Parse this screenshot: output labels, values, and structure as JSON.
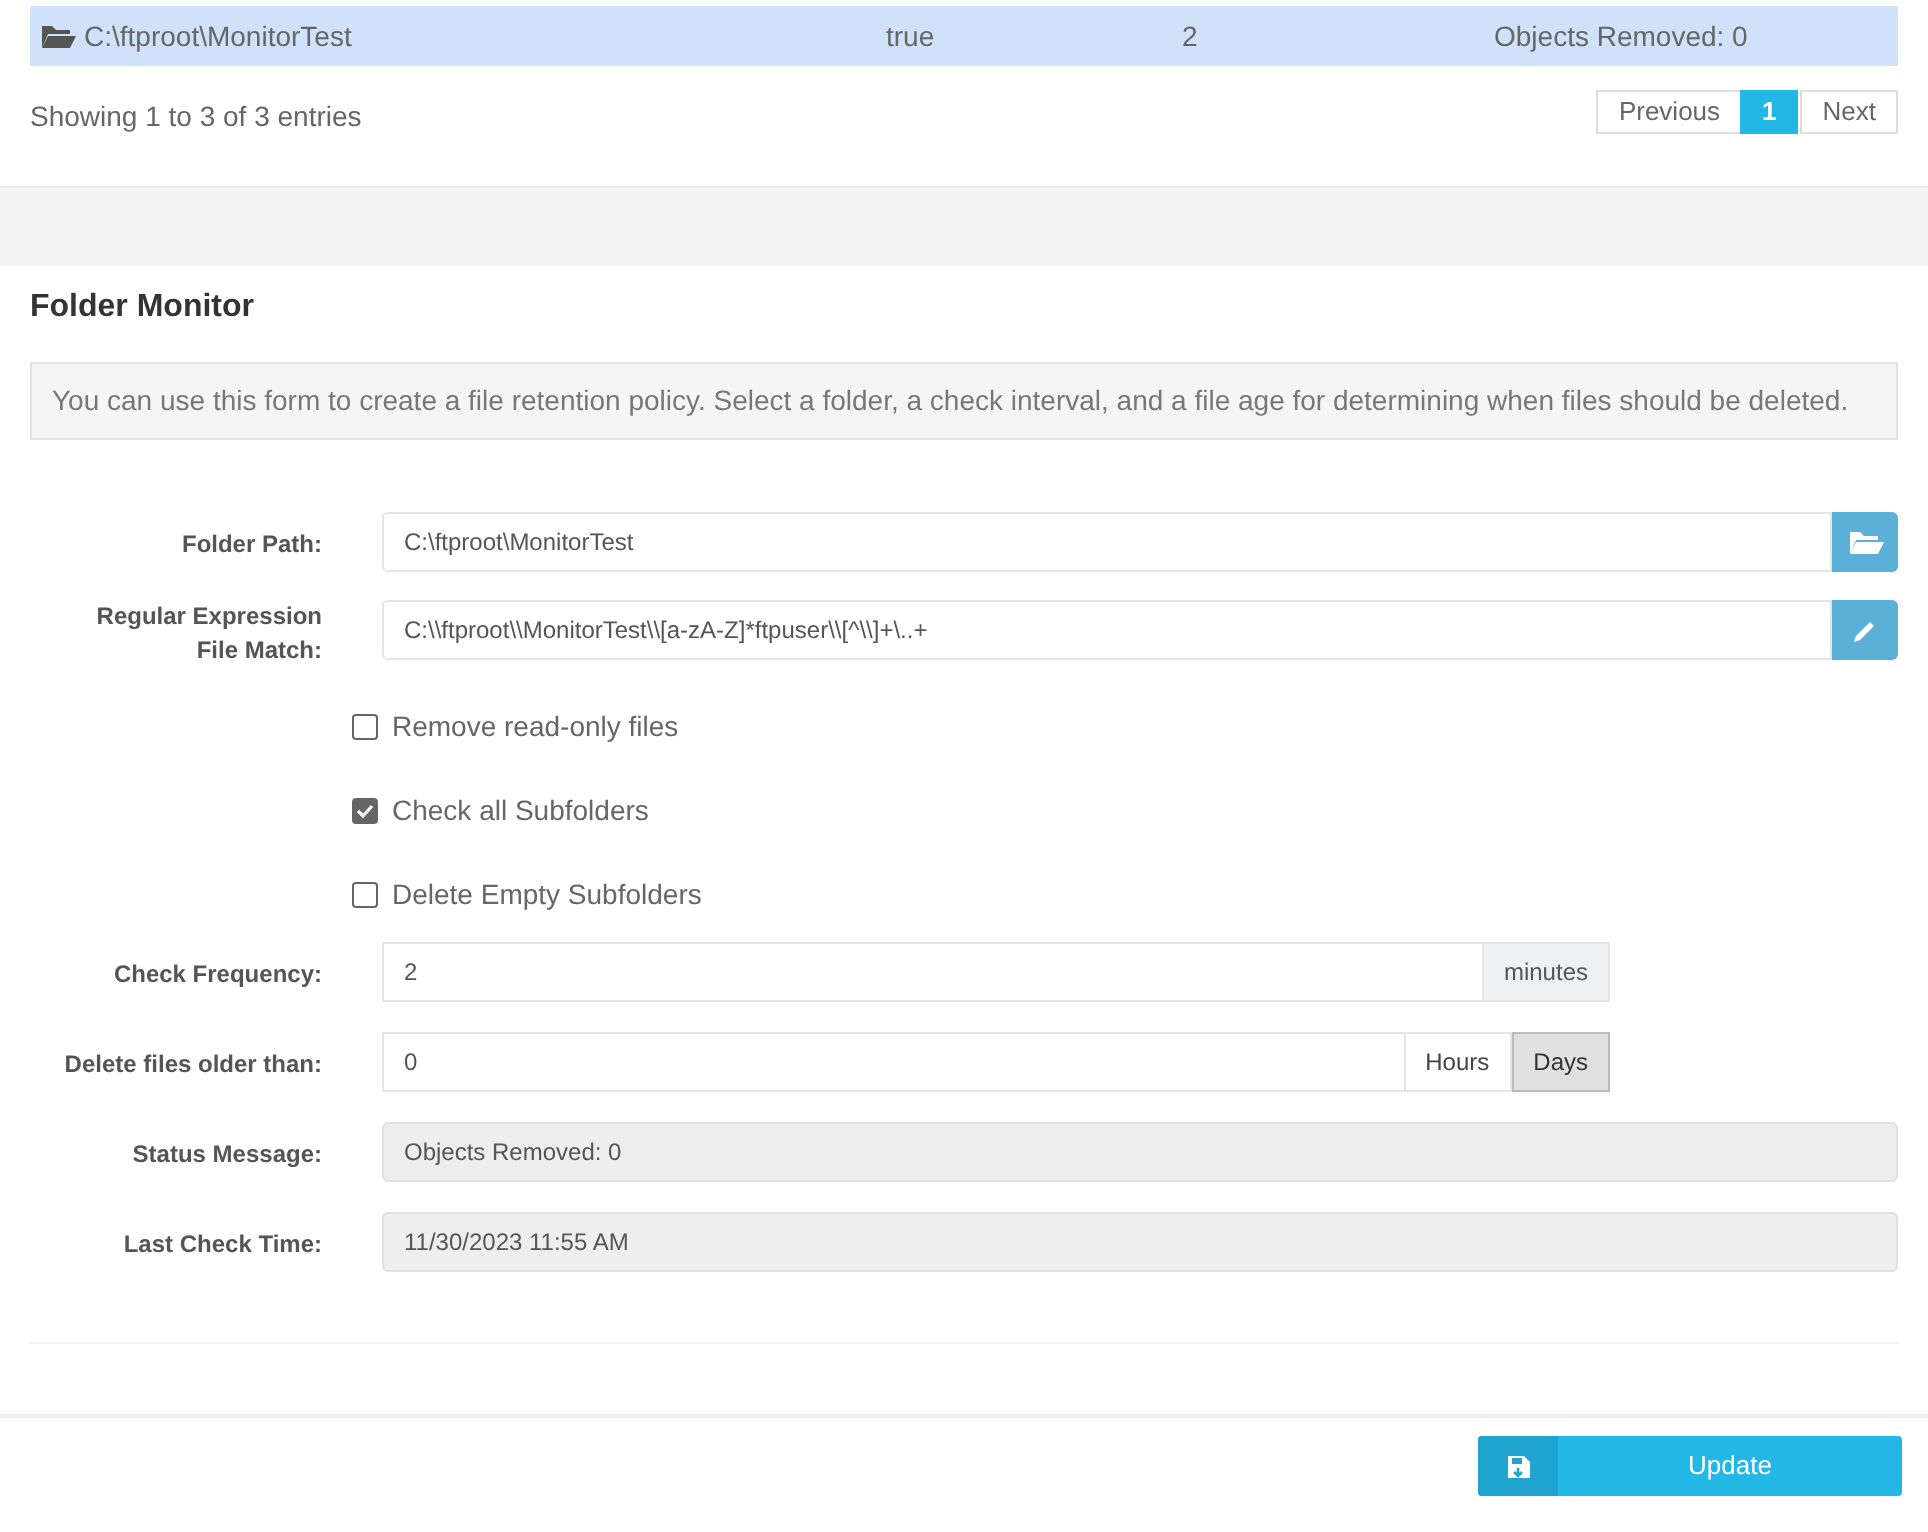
{
  "table": {
    "rows": [
      {
        "path": "C:\\ftproot\\MonitorTest",
        "column_2": "true",
        "column_3": "2",
        "column_4": "Objects Removed: 0",
        "selected": true
      }
    ]
  },
  "table_info": "Showing 1 to 3 of 3 entries",
  "pagination": [
    {
      "label": "Previous",
      "selected": false
    },
    {
      "label": "1",
      "selected": true
    },
    {
      "label": "Next",
      "selected": false
    }
  ],
  "panel": {
    "title": "Folder Monitor",
    "info": "You can use this form to create a file retention policy. Select a folder, a check interval, and a file age for determining when files should be deleted."
  },
  "folder_path": {
    "label": "Folder Path:",
    "value": "C:\\ftproot\\MonitorTest"
  },
  "regex": {
    "label": "Regular Expression File Match:",
    "value": "C:\\\\ftproot\\\\MonitorTest\\\\[a-zA-Z]*ftpuser\\\\[^\\\\]+\\..+"
  },
  "options": [
    {
      "label": "Remove read-only files",
      "checked": false
    },
    {
      "label": "Check all Subfolders",
      "checked": true
    },
    {
      "label": "Delete Empty Subfolders",
      "checked": false
    }
  ],
  "check_frequency": {
    "label": "Check Frequency:",
    "value": "2",
    "unit": "minutes"
  },
  "delete_older": {
    "label": "Delete files older than:",
    "value": "0",
    "units": [
      {
        "label": "Hours",
        "selected": false
      },
      {
        "label": "Days",
        "selected": true
      }
    ]
  },
  "status_message": {
    "label": "Status Message:",
    "value": "Objects Removed: 0"
  },
  "last_check": {
    "label": "Last Check Time:",
    "value": "11/30/2023 11:55 AM"
  },
  "update_button": "Update"
}
